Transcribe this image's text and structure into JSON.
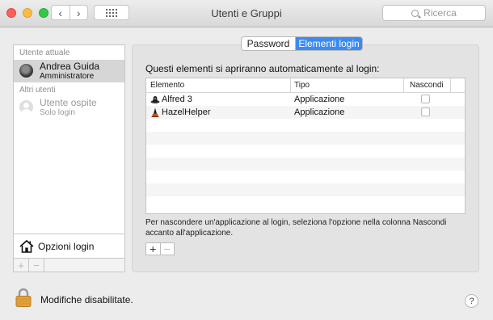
{
  "window": {
    "title": "Utenti e Gruppi"
  },
  "toolbar": {
    "back_icon": "‹",
    "forward_icon": "›",
    "grid_icon": "grid-icon"
  },
  "search": {
    "placeholder": "Ricerca"
  },
  "sidebar": {
    "current_user_label": "Utente attuale",
    "current_user": {
      "name": "Andrea Guida",
      "role": "Amministratore"
    },
    "other_users_label": "Altri utenti",
    "other_users": [
      {
        "name": "Utente ospite",
        "role": "Solo login"
      }
    ],
    "login_options_label": "Opzioni login",
    "add_label": "+",
    "remove_label": "−"
  },
  "tabs": [
    {
      "label": "Password",
      "selected": false
    },
    {
      "label": "Elementi login",
      "selected": true
    }
  ],
  "main": {
    "heading": "Questi elementi si apriranno automaticamente al login:",
    "table": {
      "columns": [
        "Elemento",
        "Tipo",
        "Nascondi"
      ],
      "rows": [
        {
          "name": "Alfred 3",
          "type": "Applicazione",
          "hide": false,
          "icon": "alfred-icon"
        },
        {
          "name": "HazelHelper",
          "type": "Applicazione",
          "hide": false,
          "icon": "hazel-icon"
        }
      ]
    },
    "note": "Per nascondere un'applicazione al login, seleziona l'opzione nella colonna Nascondi accanto all'applicazione.",
    "add_label": "+",
    "remove_label": "−"
  },
  "footer": {
    "lock_text": "Modifiche disabilitate.",
    "help_label": "?"
  },
  "colors": {
    "accent": "#3b8bf5",
    "close": "#fc605c",
    "minimize": "#fdbc40",
    "maximize": "#34c84a"
  }
}
